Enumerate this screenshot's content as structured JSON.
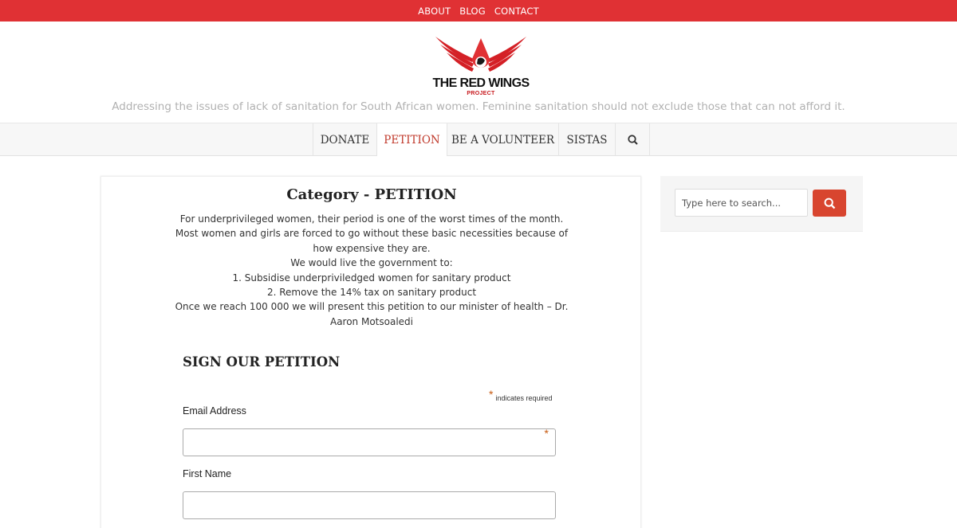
{
  "topbar": {
    "links": [
      "ABOUT",
      "BLOG",
      "CONTACT"
    ]
  },
  "brand": {
    "name": "THE RED WINGS",
    "sub": "PROJECT",
    "tagline": "Addressing the issues of lack of sanitation for South African women. Feminine sanitation should not exclude those that can not afford it.",
    "accent": "#e03134"
  },
  "nav": {
    "items": [
      "DONATE",
      "PETITION",
      "BE A VOLUNTEER",
      "SISTAS"
    ],
    "active": "PETITION",
    "search_icon": "search-icon"
  },
  "main": {
    "title": "Category - PETITION",
    "description": [
      "For underprivileged women, their period is one of the worst times of the month. Most women and girls are forced to go without these basic necessities because of how expensive they are.",
      "We would live the government to:",
      "1. Subsidise underpriviledged women for sanitary product",
      "2. Remove the 14% tax on sanitary product",
      "Once we reach 100 000 we will present this petition to our minister of health – Dr. Aaron Motsoaledi"
    ],
    "form": {
      "heading": "SIGN OUR PETITION",
      "required_note": "indicates required",
      "required_star": "*",
      "fields": [
        {
          "label": "Email Address",
          "value": "",
          "required": true
        },
        {
          "label": "First Name",
          "value": "",
          "required": false
        }
      ]
    }
  },
  "sidebar": {
    "search_placeholder": "Type here to search..."
  }
}
